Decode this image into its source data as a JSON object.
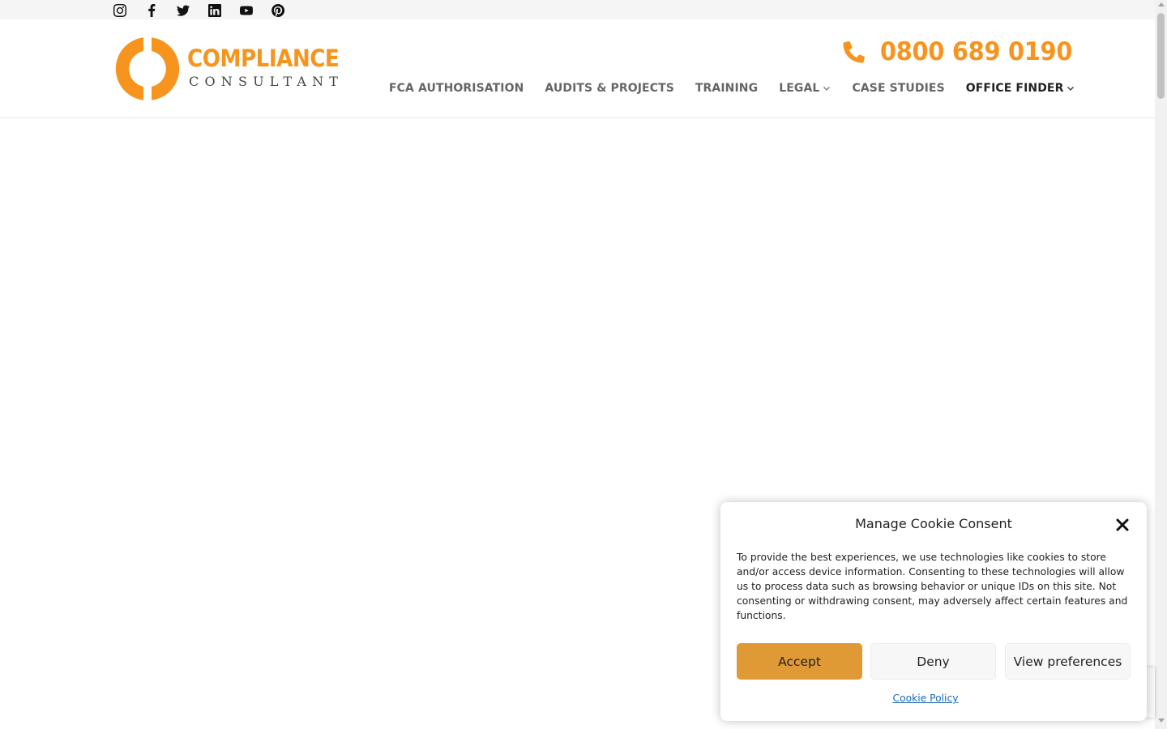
{
  "social": {
    "icons": [
      "instagram-icon",
      "facebook-icon",
      "twitter-icon",
      "linkedin-icon",
      "youtube-icon",
      "pinterest-icon"
    ]
  },
  "logo": {
    "word1": "COMPLIANCE",
    "word2": "CONSULTANT",
    "color": "#f7941d"
  },
  "phone": {
    "icon": "phone-icon",
    "number": "0800 689 0190"
  },
  "nav": {
    "items": [
      {
        "label": "FCA AUTHORISATION"
      },
      {
        "label": "AUDITS & PROJECTS"
      },
      {
        "label": "TRAINING"
      },
      {
        "label": "LEGAL"
      },
      {
        "label": "CASE STUDIES"
      },
      {
        "label": "OFFICE FINDER"
      }
    ]
  },
  "cookie": {
    "title": "Manage Cookie Consent",
    "text": "To provide the best experiences, we use technologies like cookies to store and/or access device information. Consenting to these technologies will allow us to process data such as browsing behavior or unique IDs on this site. Not consenting or withdrawing consent, may adversely affect certain features and functions.",
    "accept": "Accept",
    "deny": "Deny",
    "preferences": "View preferences",
    "policy_link": "Cookie Policy",
    "accent": "#e09a35"
  }
}
